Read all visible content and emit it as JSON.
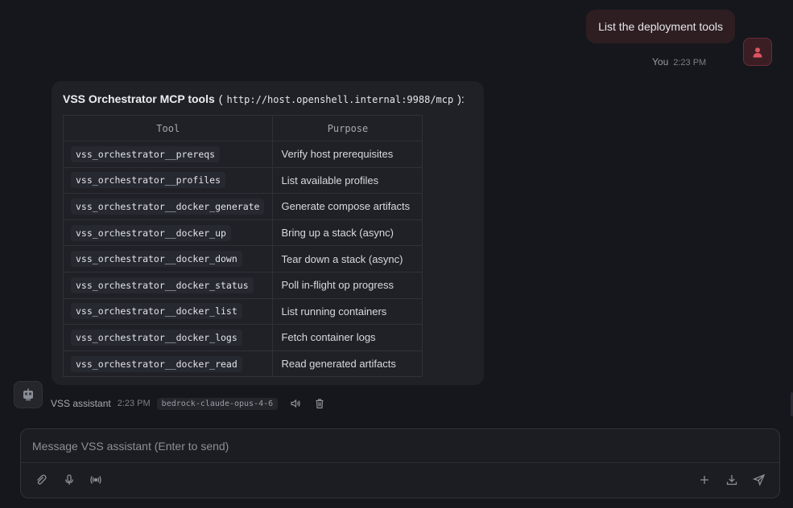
{
  "user_message": {
    "text": "List the deployment tools",
    "author": "You",
    "time": "2:23 PM"
  },
  "assistant_message": {
    "title": "VSS Orchestrator MCP tools",
    "open_paren": "(",
    "url": "http://host.openshell.internal:9988/mcp",
    "close_paren": "):",
    "table": {
      "headers": [
        "Tool",
        "Purpose"
      ],
      "rows": [
        {
          "tool": "vss_orchestrator__prereqs",
          "purpose": "Verify host prerequisites"
        },
        {
          "tool": "vss_orchestrator__profiles",
          "purpose": "List available profiles"
        },
        {
          "tool": "vss_orchestrator__docker_generate",
          "purpose": "Generate compose artifacts"
        },
        {
          "tool": "vss_orchestrator__docker_up",
          "purpose": "Bring up a stack (async)"
        },
        {
          "tool": "vss_orchestrator__docker_down",
          "purpose": "Tear down a stack (async)"
        },
        {
          "tool": "vss_orchestrator__docker_status",
          "purpose": "Poll in-flight op progress"
        },
        {
          "tool": "vss_orchestrator__docker_list",
          "purpose": "List running containers"
        },
        {
          "tool": "vss_orchestrator__docker_logs",
          "purpose": "Fetch container logs"
        },
        {
          "tool": "vss_orchestrator__docker_read",
          "purpose": "Read generated artifacts"
        }
      ]
    },
    "author": "VSS assistant",
    "time": "2:23 PM",
    "model": "bedrock-claude-opus-4-6"
  },
  "composer": {
    "placeholder": "Message VSS assistant (Enter to send)"
  },
  "icons": {
    "user_avatar": "user-icon",
    "bot_avatar": "robot-icon",
    "speak": "speaker-icon",
    "delete": "trash-icon",
    "attach": "paperclip-icon",
    "mic": "microphone-icon",
    "broadcast": "broadcast-icon",
    "add": "plus-icon",
    "download": "download-icon",
    "send": "send-icon"
  },
  "colors": {
    "background": "#15171c",
    "user_bubble": "#2e1e22",
    "user_avatar_accent": "#e0525f",
    "card": "#1f2127"
  }
}
